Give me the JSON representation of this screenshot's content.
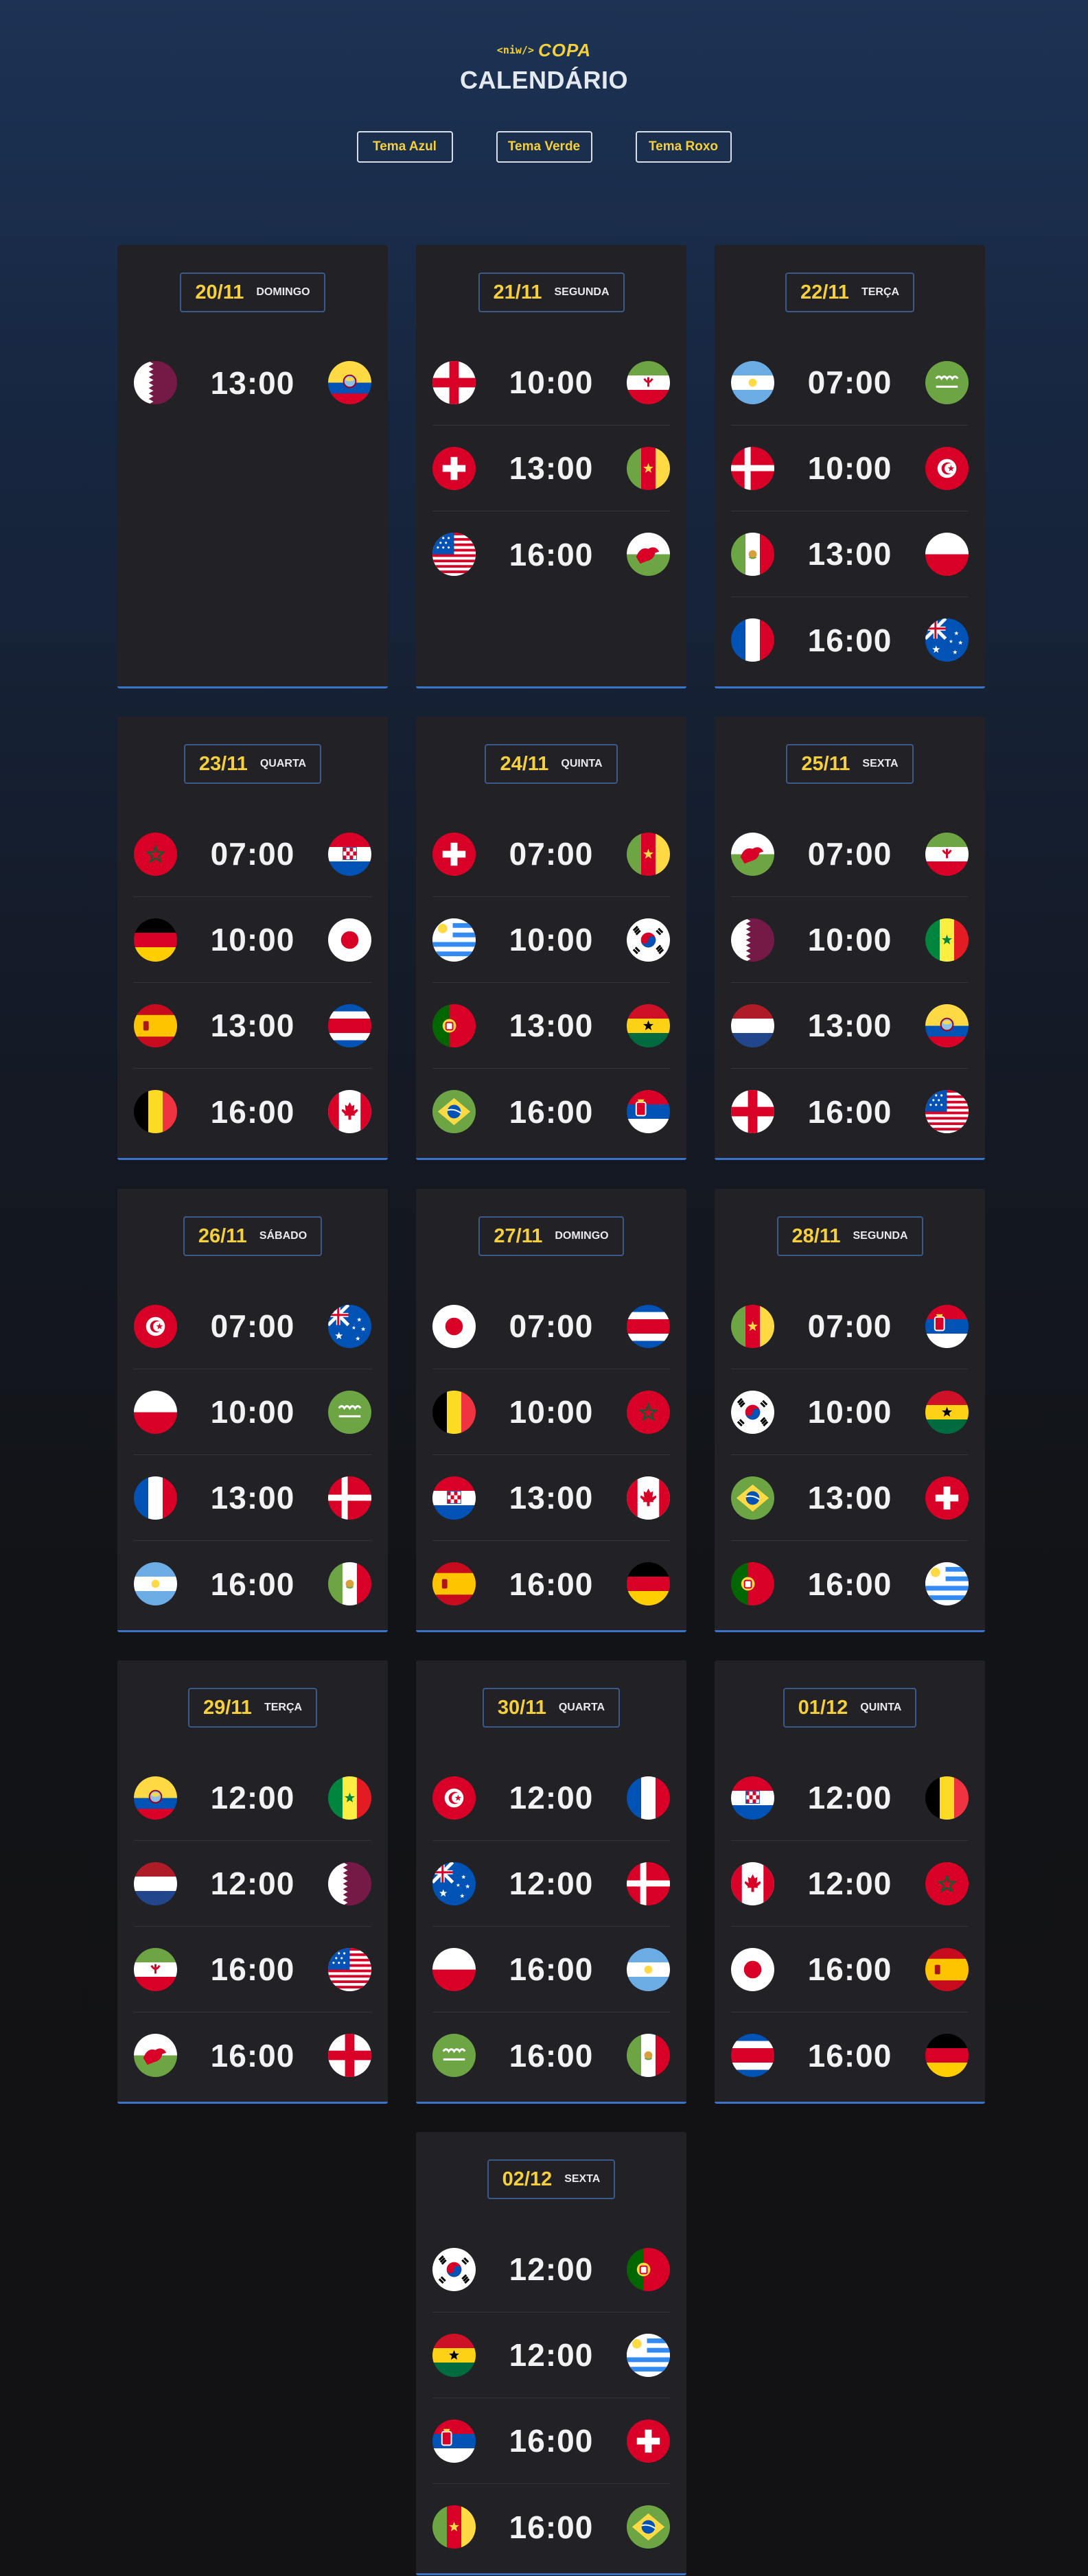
{
  "header": {
    "logo_code": "<niw/>",
    "logo_word": "COPA",
    "title": "CALENDÁRIO"
  },
  "themes": [
    "Tema Azul",
    "Tema Verde",
    "Tema Roxo"
  ],
  "days": [
    {
      "date": "20/11",
      "weekday": "DOMINGO",
      "matches": [
        [
          "qatar",
          "13:00",
          "ecuador"
        ]
      ]
    },
    {
      "date": "21/11",
      "weekday": "SEGUNDA",
      "matches": [
        [
          "england",
          "10:00",
          "iran"
        ],
        [
          "switzerland",
          "13:00",
          "cameroon"
        ],
        [
          "usa",
          "16:00",
          "wales"
        ]
      ]
    },
    {
      "date": "22/11",
      "weekday": "TERÇA",
      "matches": [
        [
          "argentina",
          "07:00",
          "saudi"
        ],
        [
          "denmark",
          "10:00",
          "tunisia"
        ],
        [
          "mexico",
          "13:00",
          "poland"
        ],
        [
          "france",
          "16:00",
          "australia"
        ]
      ]
    },
    {
      "date": "23/11",
      "weekday": "QUARTA",
      "matches": [
        [
          "morocco",
          "07:00",
          "croatia"
        ],
        [
          "germany",
          "10:00",
          "japan"
        ],
        [
          "spain",
          "13:00",
          "costarica"
        ],
        [
          "belgium",
          "16:00",
          "canada"
        ]
      ]
    },
    {
      "date": "24/11",
      "weekday": "QUINTA",
      "matches": [
        [
          "switzerland",
          "07:00",
          "cameroon"
        ],
        [
          "uruguay",
          "10:00",
          "korea"
        ],
        [
          "portugal",
          "13:00",
          "ghana"
        ],
        [
          "brazil",
          "16:00",
          "serbia"
        ]
      ]
    },
    {
      "date": "25/11",
      "weekday": "SEXTA",
      "matches": [
        [
          "wales",
          "07:00",
          "iran"
        ],
        [
          "qatar",
          "10:00",
          "senegal"
        ],
        [
          "netherlands",
          "13:00",
          "ecuador"
        ],
        [
          "england",
          "16:00",
          "usa"
        ]
      ]
    },
    {
      "date": "26/11",
      "weekday": "SÁBADO",
      "matches": [
        [
          "tunisia",
          "07:00",
          "australia"
        ],
        [
          "poland",
          "10:00",
          "saudi"
        ],
        [
          "france",
          "13:00",
          "denmark"
        ],
        [
          "argentina",
          "16:00",
          "mexico"
        ]
      ]
    },
    {
      "date": "27/11",
      "weekday": "DOMINGO",
      "matches": [
        [
          "japan",
          "07:00",
          "costarica"
        ],
        [
          "belgium",
          "10:00",
          "morocco"
        ],
        [
          "croatia",
          "13:00",
          "canada"
        ],
        [
          "spain",
          "16:00",
          "germany"
        ]
      ]
    },
    {
      "date": "28/11",
      "weekday": "SEGUNDA",
      "matches": [
        [
          "cameroon",
          "07:00",
          "serbia"
        ],
        [
          "korea",
          "10:00",
          "ghana"
        ],
        [
          "brazil",
          "13:00",
          "switzerland"
        ],
        [
          "portugal",
          "16:00",
          "uruguay"
        ]
      ]
    },
    {
      "date": "29/11",
      "weekday": "TERÇA",
      "matches": [
        [
          "ecuador",
          "12:00",
          "senegal"
        ],
        [
          "netherlands",
          "12:00",
          "qatar"
        ],
        [
          "iran",
          "16:00",
          "usa"
        ],
        [
          "wales",
          "16:00",
          "england"
        ]
      ]
    },
    {
      "date": "30/11",
      "weekday": "QUARTA",
      "matches": [
        [
          "tunisia",
          "12:00",
          "france"
        ],
        [
          "australia",
          "12:00",
          "denmark"
        ],
        [
          "poland",
          "16:00",
          "argentina"
        ],
        [
          "saudi",
          "16:00",
          "mexico"
        ]
      ]
    },
    {
      "date": "01/12",
      "weekday": "QUINTA",
      "matches": [
        [
          "croatia",
          "12:00",
          "belgium"
        ],
        [
          "canada",
          "12:00",
          "morocco"
        ],
        [
          "japan",
          "16:00",
          "spain"
        ],
        [
          "costarica",
          "16:00",
          "germany"
        ]
      ]
    },
    {
      "date": "02/12",
      "weekday": "SEXTA",
      "matches": [
        [
          "korea",
          "12:00",
          "portugal"
        ],
        [
          "ghana",
          "12:00",
          "uruguay"
        ],
        [
          "serbia",
          "16:00",
          "switzerland"
        ],
        [
          "cameroon",
          "16:00",
          "brazil"
        ]
      ]
    }
  ],
  "colors": {
    "accent": "#f5cf3c",
    "card": "#222226",
    "card_border": "#3a74c9"
  }
}
